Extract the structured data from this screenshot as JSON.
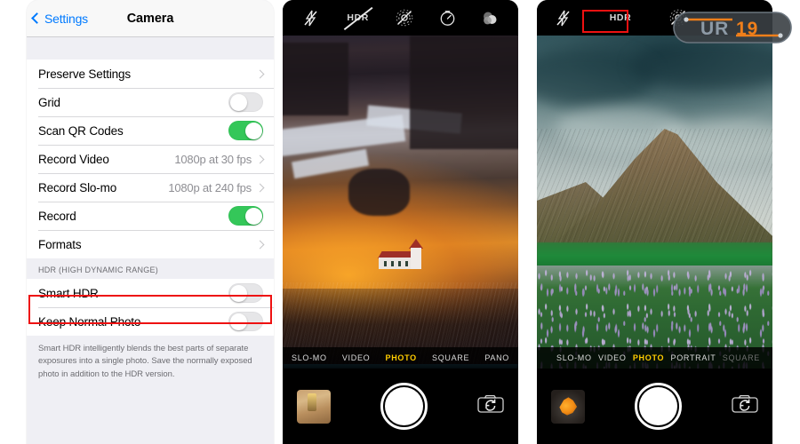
{
  "settings": {
    "nav": {
      "back_label": "Settings",
      "back_icon": "chevron-left-icon",
      "title": "Camera"
    },
    "group1": [
      {
        "label": "Preserve Settings",
        "type": "disclosure",
        "value": "",
        "accessory": "chevron-right-icon"
      },
      {
        "label": "Grid",
        "type": "toggle",
        "state": "off"
      },
      {
        "label": "Scan QR Codes",
        "type": "toggle",
        "state": "on"
      },
      {
        "label": "Record Video",
        "type": "disclosure",
        "value": "1080p at 30 fps",
        "accessory": "chevron-right-icon"
      },
      {
        "label": "Record Slo-mo",
        "type": "disclosure",
        "value": "1080p at 240 fps",
        "accessory": "chevron-right-icon"
      },
      {
        "label": "Record",
        "type": "toggle",
        "state": "on"
      },
      {
        "label": "Formats",
        "type": "disclosure",
        "value": "",
        "accessory": "chevron-right-icon"
      }
    ],
    "section_header": "HDR (HIGH DYNAMIC RANGE)",
    "group2": [
      {
        "label": "Smart HDR",
        "type": "toggle",
        "state": "off",
        "highlighted": true
      },
      {
        "label": "Keep Normal Photo",
        "type": "toggle",
        "state": "off",
        "highlighted": false
      }
    ],
    "footer_note": "Smart HDR intelligently blends the best parts of separate exposures into a single photo. Save the normally exposed photo in addition to the HDR version."
  },
  "camera_middle": {
    "top_controls": [
      {
        "name": "flash-off-icon",
        "label": ""
      },
      {
        "name": "hdr-off-icon",
        "label": "HDR"
      },
      {
        "name": "live-photo-off-icon",
        "label": ""
      },
      {
        "name": "timer-icon",
        "label": ""
      },
      {
        "name": "filters-icon",
        "label": ""
      }
    ],
    "modes": [
      {
        "label": "SLO-MO",
        "active": false
      },
      {
        "label": "VIDEO",
        "active": false
      },
      {
        "label": "PHOTO",
        "active": true
      },
      {
        "label": "SQUARE",
        "active": false
      },
      {
        "label": "PANO",
        "active": false
      }
    ],
    "bottom": {
      "thumbnail_name": "photo-library-thumbnail",
      "shutter_name": "shutter-button",
      "flip_name": "flip-camera-icon"
    },
    "scene": "Sunset-lit mountain cliffs above a white church with red roof"
  },
  "camera_right": {
    "top_controls": [
      {
        "name": "flash-off-icon",
        "label": ""
      },
      {
        "name": "hdr-on-icon",
        "label": "HDR"
      },
      {
        "name": "live-photo-off-icon",
        "label": ""
      }
    ],
    "modes": [
      {
        "label": "SLO-MO",
        "active": false
      },
      {
        "label": "VIDEO",
        "active": false
      },
      {
        "label": "PHOTO",
        "active": true
      },
      {
        "label": "PORTRAIT",
        "active": false
      },
      {
        "label": "SQUARE",
        "active": false
      }
    ],
    "bottom": {
      "thumbnail_name": "photo-library-thumbnail",
      "shutter_name": "shutter-button",
      "flip_name": "flip-camera-icon"
    },
    "scene": "Brown conical peak under moody clouds above a purple lupine field"
  },
  "highlight_color": "#ee1111",
  "accent_color": "#007aff",
  "toggle_on_color": "#34c759",
  "mode_active_color": "#ffcc00",
  "watermark": {
    "name": "site-logo-watermark",
    "text": "UR19",
    "color_primary": "#f07f1a",
    "color_secondary": "#8d9aa6"
  }
}
